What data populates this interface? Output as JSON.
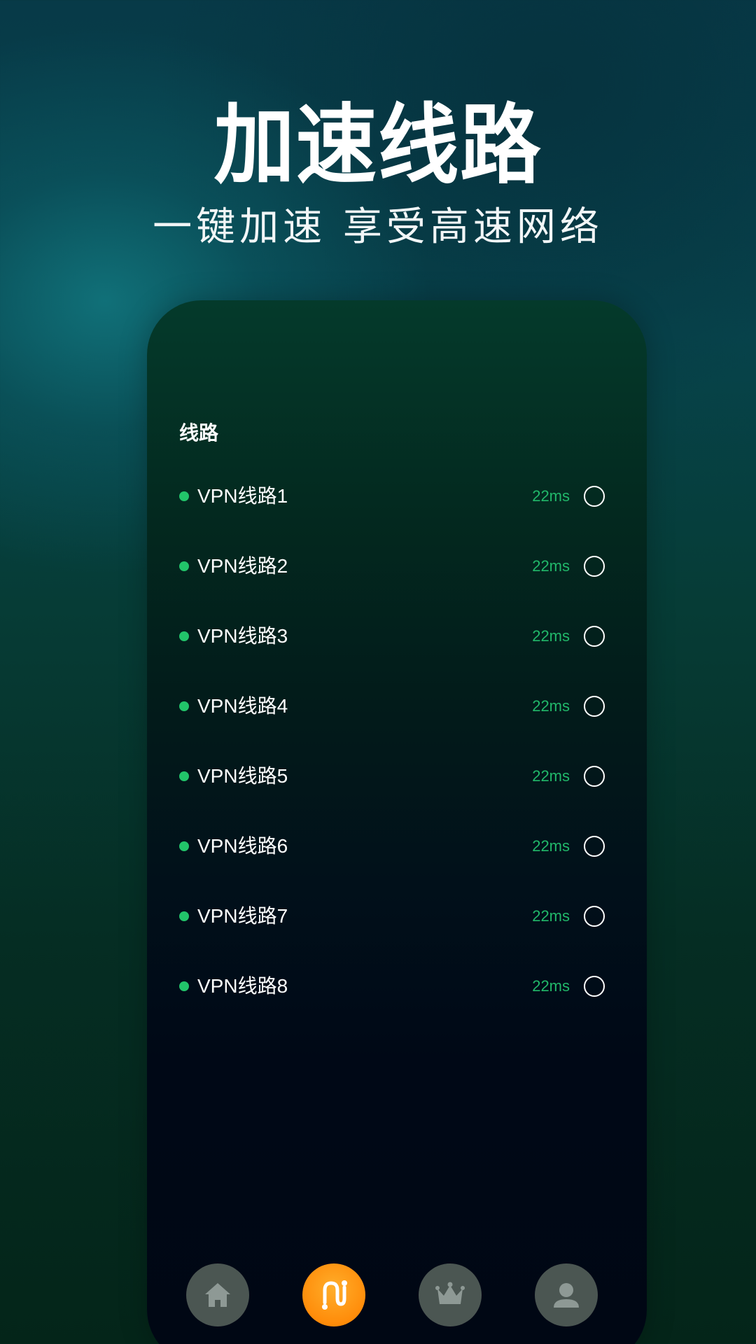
{
  "promo": {
    "title": "加速线路",
    "subtitle": "一键加速 享受高速网络"
  },
  "route_section": {
    "label": "线路",
    "routes": [
      {
        "name": "VPN线路1",
        "latency": "22ms"
      },
      {
        "name": "VPN线路2",
        "latency": "22ms"
      },
      {
        "name": "VPN线路3",
        "latency": "22ms"
      },
      {
        "name": "VPN线路4",
        "latency": "22ms"
      },
      {
        "name": "VPN线路5",
        "latency": "22ms"
      },
      {
        "name": "VPN线路6",
        "latency": "22ms"
      },
      {
        "name": "VPN线路7",
        "latency": "22ms"
      },
      {
        "name": "VPN线路8",
        "latency": "22ms"
      }
    ]
  },
  "tab_bar": {
    "tabs": [
      {
        "icon": "home-icon",
        "active": false
      },
      {
        "icon": "route-icon",
        "active": true
      },
      {
        "icon": "crown-icon",
        "active": false
      },
      {
        "icon": "profile-icon",
        "active": false
      }
    ]
  },
  "colors": {
    "accent_orange": "#ff8c0a",
    "status_green": "#22c46a",
    "latency_green": "#21b86a",
    "tab_inactive": "#4b5652"
  }
}
